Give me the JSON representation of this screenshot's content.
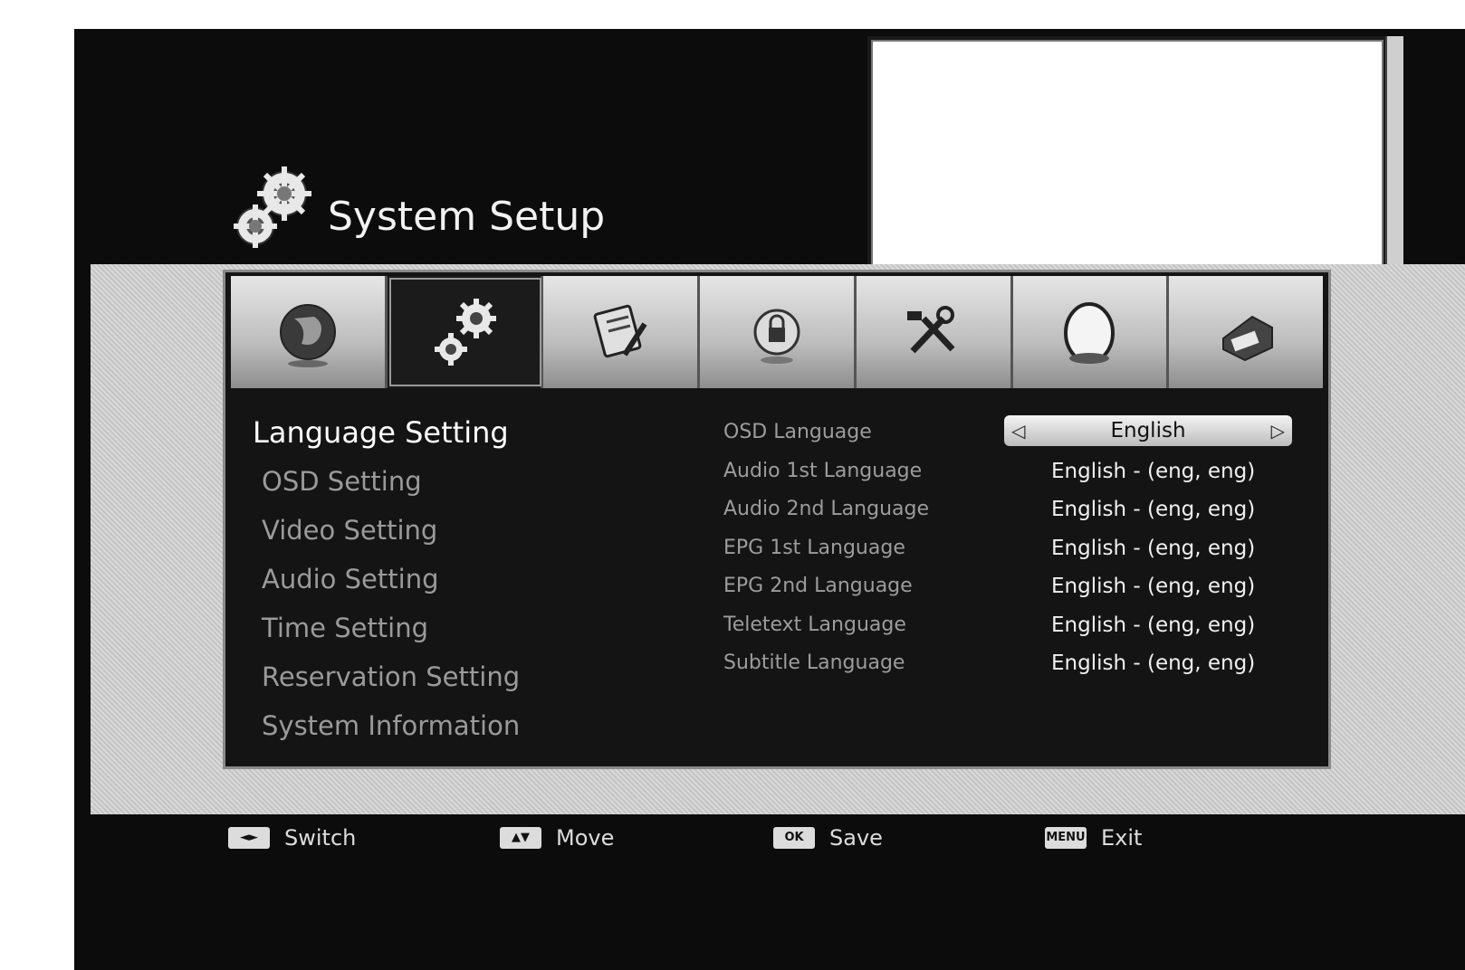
{
  "header": {
    "title": "System Setup"
  },
  "tabs": [
    {
      "icon": "globe-icon",
      "active": false
    },
    {
      "icon": "gears-icon",
      "active": true
    },
    {
      "icon": "edit-icon",
      "active": false
    },
    {
      "icon": "lock-icon",
      "active": false
    },
    {
      "icon": "tools-icon",
      "active": false
    },
    {
      "icon": "disc-icon",
      "active": false
    },
    {
      "icon": "media-icon",
      "active": false
    }
  ],
  "menu": {
    "items": [
      {
        "label": "Language Setting",
        "active": true
      },
      {
        "label": "OSD Setting"
      },
      {
        "label": "Video Setting"
      },
      {
        "label": "Audio Setting"
      },
      {
        "label": "Time Setting"
      },
      {
        "label": "Reservation Setting"
      },
      {
        "label": "System Information"
      }
    ]
  },
  "settings": {
    "rows": [
      {
        "label": "OSD Language",
        "value": "English",
        "selector": true
      },
      {
        "label": "Audio 1st Language",
        "value": "English - (eng, eng)"
      },
      {
        "label": "Audio 2nd Language",
        "value": "English - (eng, eng)"
      },
      {
        "label": "EPG 1st Language",
        "value": "English - (eng, eng)"
      },
      {
        "label": "EPG 2nd Language",
        "value": "English - (eng, eng)"
      },
      {
        "label": "Teletext Language",
        "value": "English - (eng, eng)"
      },
      {
        "label": "Subtitle Language",
        "value": "English - (eng, eng)"
      }
    ]
  },
  "footer": {
    "hints": [
      {
        "key": "◄►",
        "label": "Switch"
      },
      {
        "key": "▲▼",
        "label": "Move"
      },
      {
        "key": "OK",
        "label": "Save"
      },
      {
        "key": "MENU",
        "label": "Exit"
      }
    ]
  },
  "colors": {
    "screen_bg": "#0c0c0c",
    "panel_bg": "#141414",
    "active_text": "#ffffff",
    "inactive_text": "#9a9a9a"
  }
}
